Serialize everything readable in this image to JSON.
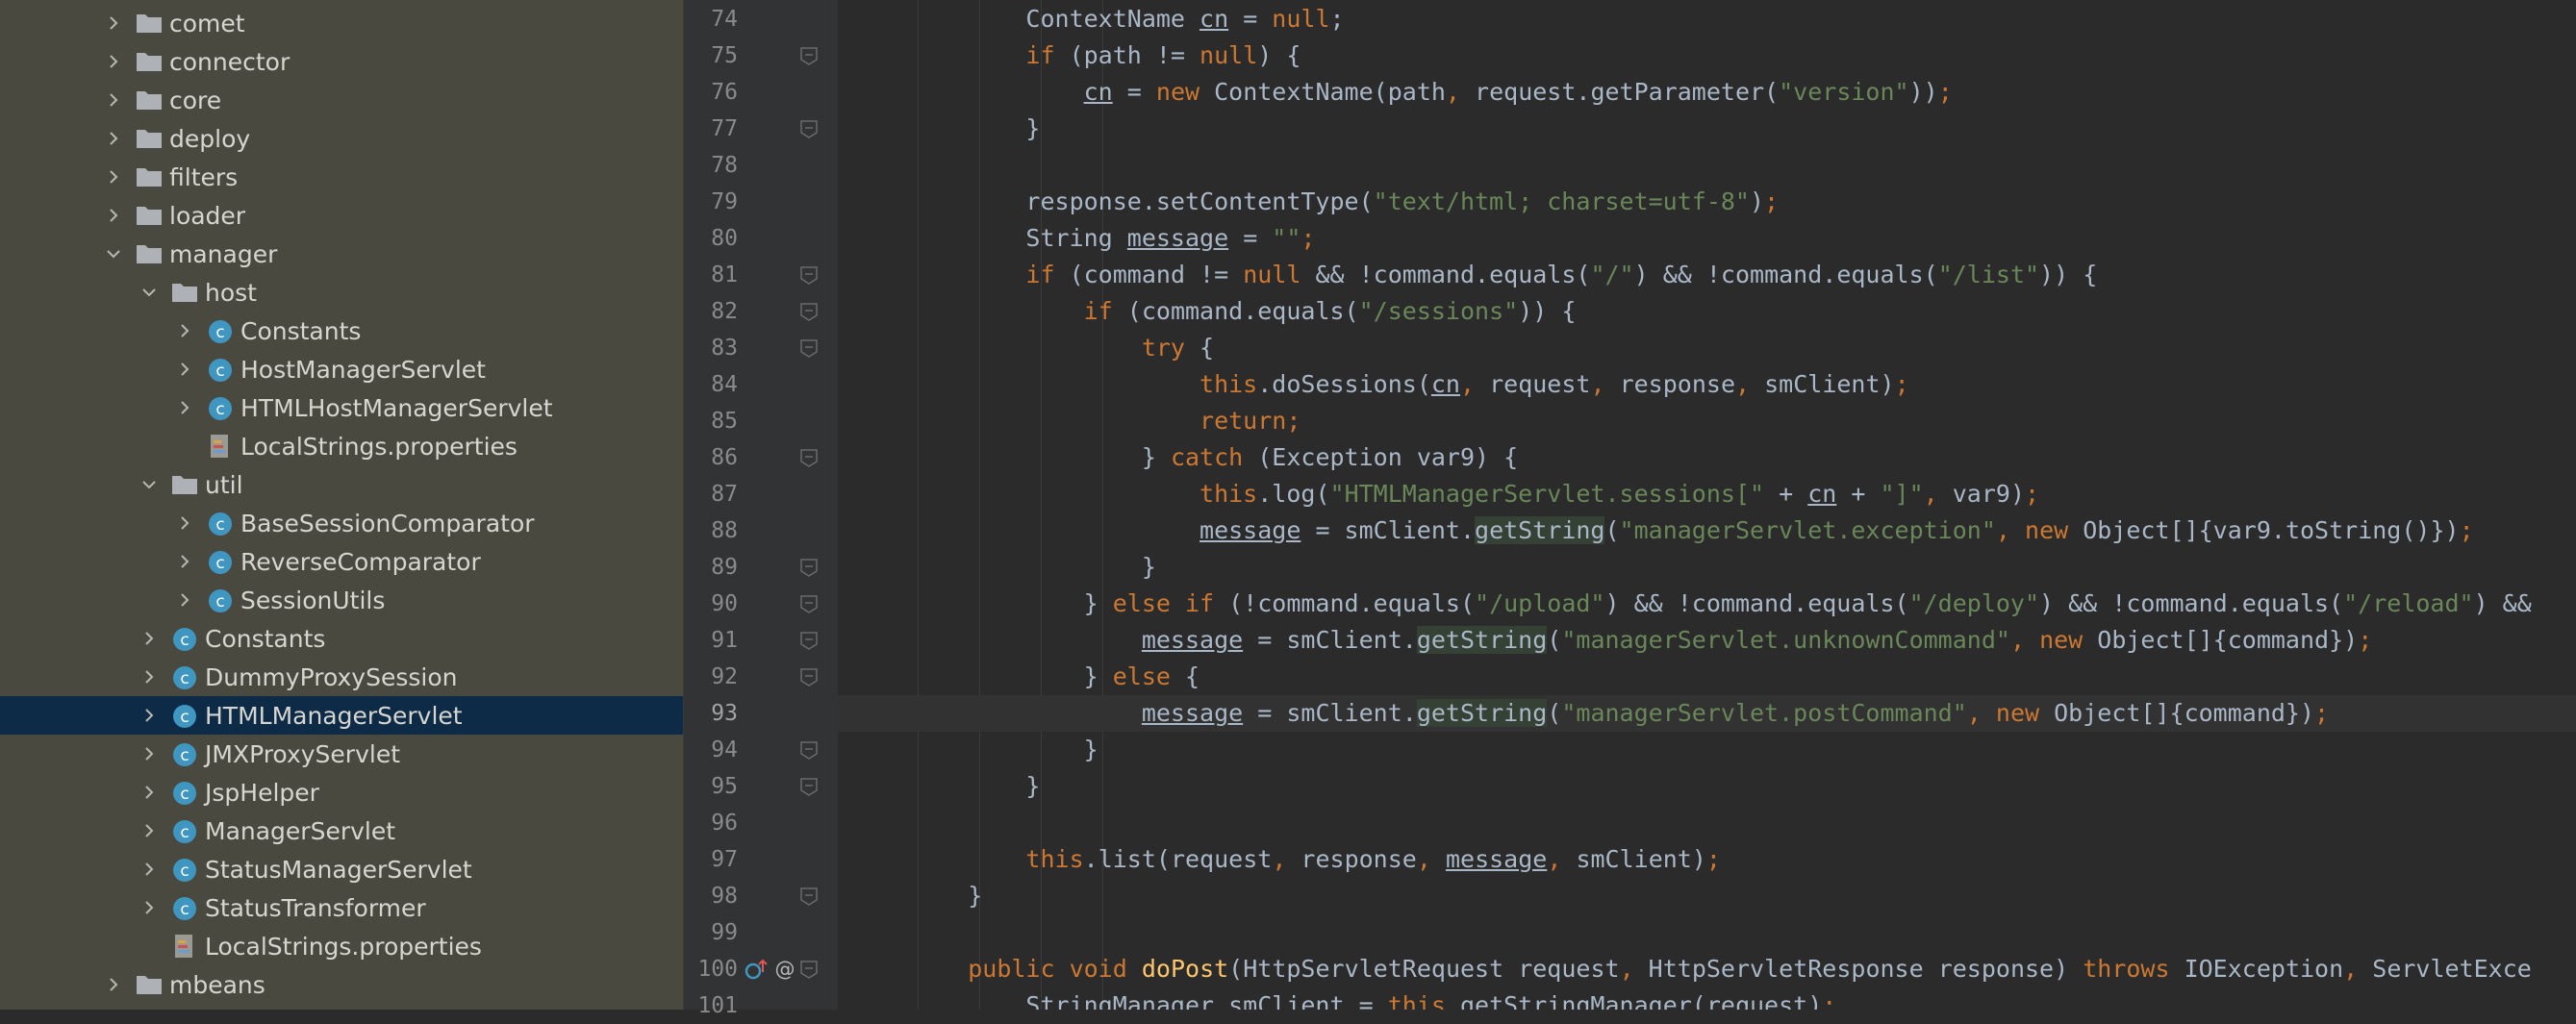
{
  "colors": {
    "tree_bg": "#4a4940",
    "tree_selected": "#0d2a47",
    "tree_text": "#d6d6d0",
    "folder": "#aeb2b6",
    "class_icon": "#3f97c1",
    "editor_bg": "#2b2b2b",
    "gutter_bg": "#313335",
    "keyword": "#cc7832",
    "string": "#6a8759",
    "method": "#ffc66d",
    "plain": "#a9b7c6"
  },
  "tree": [
    {
      "label": "comet",
      "depth": 0,
      "icon": "folder-icon",
      "chevron": "chevron-right-icon"
    },
    {
      "label": "connector",
      "depth": 0,
      "icon": "folder-icon",
      "chevron": "chevron-right-icon"
    },
    {
      "label": "core",
      "depth": 0,
      "icon": "folder-icon",
      "chevron": "chevron-right-icon"
    },
    {
      "label": "deploy",
      "depth": 0,
      "icon": "folder-icon",
      "chevron": "chevron-right-icon"
    },
    {
      "label": "filters",
      "depth": 0,
      "icon": "folder-icon",
      "chevron": "chevron-right-icon"
    },
    {
      "label": "loader",
      "depth": 0,
      "icon": "folder-icon",
      "chevron": "chevron-right-icon"
    },
    {
      "label": "manager",
      "depth": 0,
      "icon": "folder-icon",
      "chevron": "chevron-down-icon"
    },
    {
      "label": "host",
      "depth": 1,
      "icon": "folder-icon",
      "chevron": "chevron-down-icon"
    },
    {
      "label": "Constants",
      "depth": 2,
      "icon": "class-icon",
      "chevron": "chevron-right-icon"
    },
    {
      "label": "HostManagerServlet",
      "depth": 2,
      "icon": "class-icon",
      "chevron": "chevron-right-icon"
    },
    {
      "label": "HTMLHostManagerServlet",
      "depth": 2,
      "icon": "class-icon",
      "chevron": "chevron-right-icon"
    },
    {
      "label": "LocalStrings.properties",
      "depth": 2,
      "icon": "properties-file-icon",
      "chevron": ""
    },
    {
      "label": "util",
      "depth": 1,
      "icon": "folder-icon",
      "chevron": "chevron-down-icon"
    },
    {
      "label": "BaseSessionComparator",
      "depth": 2,
      "icon": "class-icon",
      "chevron": "chevron-right-icon"
    },
    {
      "label": "ReverseComparator",
      "depth": 2,
      "icon": "class-icon",
      "chevron": "chevron-right-icon"
    },
    {
      "label": "SessionUtils",
      "depth": 2,
      "icon": "class-icon",
      "chevron": "chevron-right-icon"
    },
    {
      "label": "Constants",
      "depth": 1,
      "icon": "class-icon",
      "chevron": "chevron-right-icon"
    },
    {
      "label": "DummyProxySession",
      "depth": 1,
      "icon": "class-icon",
      "chevron": "chevron-right-icon"
    },
    {
      "label": "HTMLManagerServlet",
      "depth": 1,
      "icon": "class-icon",
      "chevron": "chevron-right-icon",
      "selected": true
    },
    {
      "label": "JMXProxyServlet",
      "depth": 1,
      "icon": "class-icon",
      "chevron": "chevron-right-icon"
    },
    {
      "label": "JspHelper",
      "depth": 1,
      "icon": "class-icon",
      "chevron": "chevron-right-icon"
    },
    {
      "label": "ManagerServlet",
      "depth": 1,
      "icon": "class-icon",
      "chevron": "chevron-right-icon"
    },
    {
      "label": "StatusManagerServlet",
      "depth": 1,
      "icon": "class-icon",
      "chevron": "chevron-right-icon"
    },
    {
      "label": "StatusTransformer",
      "depth": 1,
      "icon": "class-icon",
      "chevron": "chevron-right-icon"
    },
    {
      "label": "LocalStrings.properties",
      "depth": 1,
      "icon": "properties-file-icon",
      "chevron": ""
    },
    {
      "label": "mbeans",
      "depth": 0,
      "icon": "folder-icon",
      "chevron": "chevron-right-icon"
    }
  ],
  "editor": {
    "current_line": 93,
    "lines": [
      {
        "num": 74,
        "tokens": [
          [
            "p",
            "        ContextName "
          ],
          [
            "u",
            "cn"
          ],
          [
            "p",
            " = "
          ],
          [
            "k",
            "null"
          ],
          [
            "p",
            ";"
          ]
        ]
      },
      {
        "num": 75,
        "tokens": [
          [
            "p",
            "        "
          ],
          [
            "k",
            "if"
          ],
          [
            "p",
            " (path != "
          ],
          [
            "k",
            "null"
          ],
          [
            "p",
            ") {"
          ]
        ]
      },
      {
        "num": 76,
        "tokens": [
          [
            "p",
            "            "
          ],
          [
            "u",
            "cn"
          ],
          [
            "p",
            " = "
          ],
          [
            "k",
            "new"
          ],
          [
            "p",
            " ContextName(path"
          ],
          [
            "k",
            ","
          ],
          [
            "p",
            " request.getParameter("
          ],
          [
            "s",
            "\"version\""
          ],
          [
            "p",
            "))"
          ],
          [
            "k",
            ";"
          ]
        ]
      },
      {
        "num": 77,
        "tokens": [
          [
            "p",
            "        }"
          ]
        ]
      },
      {
        "num": 78,
        "tokens": []
      },
      {
        "num": 79,
        "tokens": [
          [
            "p",
            "        response.setContentType("
          ],
          [
            "s",
            "\"text/html; charset=utf-8\""
          ],
          [
            "p",
            ")"
          ],
          [
            "k",
            ";"
          ]
        ]
      },
      {
        "num": 80,
        "tokens": [
          [
            "p",
            "        String "
          ],
          [
            "u",
            "message"
          ],
          [
            "p",
            " = "
          ],
          [
            "s",
            "\"\""
          ],
          [
            "k",
            ";"
          ]
        ]
      },
      {
        "num": 81,
        "tokens": [
          [
            "p",
            "        "
          ],
          [
            "k",
            "if"
          ],
          [
            "p",
            " (command != "
          ],
          [
            "k",
            "null"
          ],
          [
            "p",
            " && !command.equals("
          ],
          [
            "s",
            "\"/\""
          ],
          [
            "p",
            ") && !command.equals("
          ],
          [
            "s",
            "\"/list\""
          ],
          [
            "p",
            ")) {"
          ]
        ]
      },
      {
        "num": 82,
        "tokens": [
          [
            "p",
            "            "
          ],
          [
            "k",
            "if"
          ],
          [
            "p",
            " (command.equals("
          ],
          [
            "s",
            "\"/sessions\""
          ],
          [
            "p",
            ")) {"
          ]
        ]
      },
      {
        "num": 83,
        "tokens": [
          [
            "p",
            "                "
          ],
          [
            "k",
            "try"
          ],
          [
            "p",
            " {"
          ]
        ]
      },
      {
        "num": 84,
        "tokens": [
          [
            "p",
            "                    "
          ],
          [
            "k",
            "this"
          ],
          [
            "p",
            ".doSessions("
          ],
          [
            "u",
            "cn"
          ],
          [
            "k",
            ","
          ],
          [
            "p",
            " request"
          ],
          [
            "k",
            ","
          ],
          [
            "p",
            " response"
          ],
          [
            "k",
            ","
          ],
          [
            "p",
            " smClient)"
          ],
          [
            "k",
            ";"
          ]
        ]
      },
      {
        "num": 85,
        "tokens": [
          [
            "p",
            "                    "
          ],
          [
            "k",
            "return;"
          ]
        ]
      },
      {
        "num": 86,
        "tokens": [
          [
            "p",
            "                } "
          ],
          [
            "k",
            "catch"
          ],
          [
            "p",
            " (Exception var9) {"
          ]
        ]
      },
      {
        "num": 87,
        "tokens": [
          [
            "p",
            "                    "
          ],
          [
            "k",
            "this"
          ],
          [
            "p",
            ".log("
          ],
          [
            "s",
            "\"HTMLManagerServlet.sessions[\""
          ],
          [
            "p",
            " + "
          ],
          [
            "u",
            "cn"
          ],
          [
            "p",
            " + "
          ],
          [
            "s",
            "\"]\""
          ],
          [
            "k",
            ","
          ],
          [
            "p",
            " var9)"
          ],
          [
            "k",
            ";"
          ]
        ]
      },
      {
        "num": 88,
        "tokens": [
          [
            "p",
            "                    "
          ],
          [
            "u",
            "message"
          ],
          [
            "p",
            " = smClient."
          ],
          [
            "h",
            "getString"
          ],
          [
            "p",
            "("
          ],
          [
            "s",
            "\"managerServlet.exception\""
          ],
          [
            "k",
            ","
          ],
          [
            "p",
            " "
          ],
          [
            "k",
            "new"
          ],
          [
            "p",
            " Object[]{var9.toString()})"
          ],
          [
            "k",
            ";"
          ]
        ]
      },
      {
        "num": 89,
        "tokens": [
          [
            "p",
            "                }"
          ]
        ]
      },
      {
        "num": 90,
        "tokens": [
          [
            "p",
            "            } "
          ],
          [
            "k",
            "else if"
          ],
          [
            "p",
            " (!command.equals("
          ],
          [
            "s",
            "\"/upload\""
          ],
          [
            "p",
            ") && !command.equals("
          ],
          [
            "s",
            "\"/deploy\""
          ],
          [
            "p",
            ") && !command.equals("
          ],
          [
            "s",
            "\"/reload\""
          ],
          [
            "p",
            ") &&"
          ]
        ]
      },
      {
        "num": 91,
        "tokens": [
          [
            "p",
            "                "
          ],
          [
            "u",
            "message"
          ],
          [
            "p",
            " = smClient."
          ],
          [
            "h",
            "getString"
          ],
          [
            "p",
            "("
          ],
          [
            "s",
            "\"managerServlet.unknownCommand\""
          ],
          [
            "k",
            ","
          ],
          [
            "p",
            " "
          ],
          [
            "k",
            "new"
          ],
          [
            "p",
            " Object[]{command})"
          ],
          [
            "k",
            ";"
          ]
        ]
      },
      {
        "num": 92,
        "tokens": [
          [
            "p",
            "            } "
          ],
          [
            "k",
            "else"
          ],
          [
            "p",
            " {"
          ]
        ]
      },
      {
        "num": 93,
        "tokens": [
          [
            "p",
            "                "
          ],
          [
            "u",
            "message"
          ],
          [
            "p",
            " = smClient."
          ],
          [
            "h",
            "getString"
          ],
          [
            "p",
            "("
          ],
          [
            "s",
            "\"managerServlet.postCommand\""
          ],
          [
            "k",
            ","
          ],
          [
            "p",
            " "
          ],
          [
            "k",
            "new"
          ],
          [
            "p",
            " Object[]{command})"
          ],
          [
            "k",
            ";"
          ]
        ]
      },
      {
        "num": 94,
        "tokens": [
          [
            "p",
            "            }"
          ]
        ]
      },
      {
        "num": 95,
        "tokens": [
          [
            "p",
            "        }"
          ]
        ]
      },
      {
        "num": 96,
        "tokens": []
      },
      {
        "num": 97,
        "tokens": [
          [
            "p",
            "        "
          ],
          [
            "k",
            "this"
          ],
          [
            "p",
            ".list(request"
          ],
          [
            "k",
            ","
          ],
          [
            "p",
            " response"
          ],
          [
            "k",
            ","
          ],
          [
            "p",
            " "
          ],
          [
            "u",
            "message"
          ],
          [
            "k",
            ","
          ],
          [
            "p",
            " smClient)"
          ],
          [
            "k",
            ";"
          ]
        ]
      },
      {
        "num": 98,
        "tokens": [
          [
            "p",
            "    }"
          ]
        ]
      },
      {
        "num": 99,
        "tokens": []
      },
      {
        "num": 100,
        "tokens": [
          [
            "p",
            "    "
          ],
          [
            "k",
            "public void"
          ],
          [
            "p",
            " "
          ],
          [
            "f",
            "doPost"
          ],
          [
            "p",
            "(HttpServletRequest request"
          ],
          [
            "k",
            ","
          ],
          [
            "p",
            " HttpServletResponse response) "
          ],
          [
            "k",
            "throws"
          ],
          [
            "p",
            " IOException"
          ],
          [
            "k",
            ","
          ],
          [
            "p",
            " ServletExce"
          ]
        ]
      },
      {
        "num": 101,
        "tokens": [
          [
            "p",
            "        StringManager smClient = "
          ],
          [
            "k",
            "this"
          ],
          [
            "p",
            ".getStringManager(request)"
          ],
          [
            "k",
            ";"
          ]
        ]
      }
    ]
  }
}
